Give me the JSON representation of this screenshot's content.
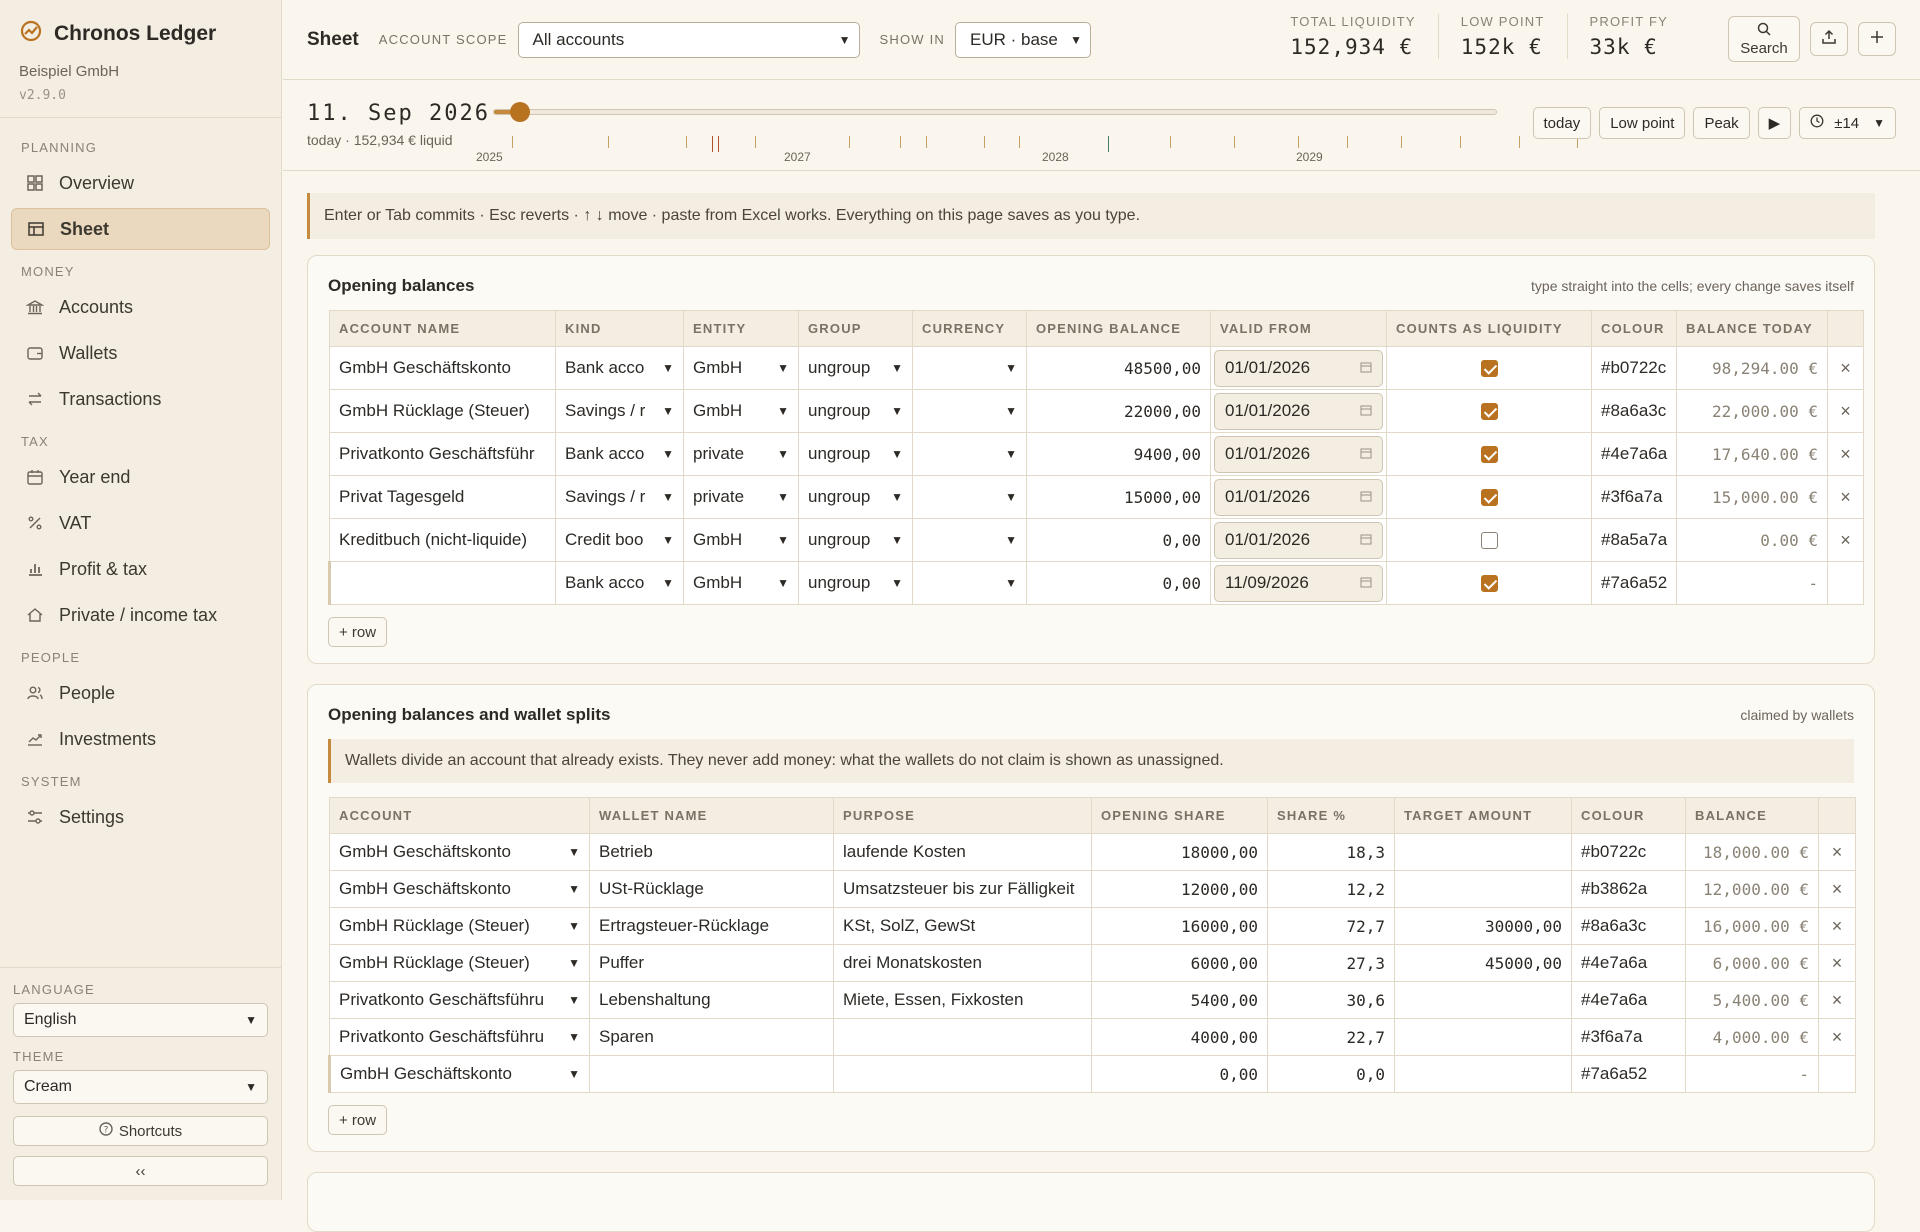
{
  "app": {
    "title": "Chronos Ledger",
    "company": "Beispiel GmbH",
    "version": "v2.9.0"
  },
  "sidebar": {
    "sections": [
      {
        "label": "PLANNING",
        "items": [
          {
            "label": "Overview",
            "icon": "grid-icon"
          },
          {
            "label": "Sheet",
            "icon": "table-icon",
            "active": true
          }
        ]
      },
      {
        "label": "MONEY",
        "items": [
          {
            "label": "Accounts",
            "icon": "bank-icon"
          },
          {
            "label": "Wallets",
            "icon": "wallet-icon"
          },
          {
            "label": "Transactions",
            "icon": "transfer-icon"
          }
        ]
      },
      {
        "label": "TAX",
        "items": [
          {
            "label": "Year end",
            "icon": "calendar-icon"
          },
          {
            "label": "VAT",
            "icon": "percent-icon"
          },
          {
            "label": "Profit & tax",
            "icon": "bar-chart-icon"
          },
          {
            "label": "Private / income tax",
            "icon": "home-icon"
          }
        ]
      },
      {
        "label": "PEOPLE",
        "items": [
          {
            "label": "People",
            "icon": "people-icon"
          },
          {
            "label": "Investments",
            "icon": "trend-icon"
          }
        ]
      },
      {
        "label": "SYSTEM",
        "items": [
          {
            "label": "Settings",
            "icon": "sliders-icon"
          }
        ]
      }
    ],
    "language_label": "LANGUAGE",
    "language_value": "English",
    "theme_label": "THEME",
    "theme_value": "Cream",
    "shortcuts_label": "Shortcuts",
    "collapse_label": "‹‹"
  },
  "topbar": {
    "title": "Sheet",
    "scope_label": "ACCOUNT SCOPE",
    "scope_value": "All accounts",
    "show_label": "SHOW IN",
    "show_value": "EUR · base",
    "kpis": [
      {
        "label": "TOTAL LIQUIDITY",
        "value": "152,934 €"
      },
      {
        "label": "LOW POINT",
        "value": "152k €"
      },
      {
        "label": "PROFIT FY",
        "value": "33k €"
      }
    ],
    "search_label": "Search"
  },
  "timeline": {
    "date": "11. Sep 2026",
    "sub": "today · 152,934 € liquid",
    "years": [
      "2025",
      "2027",
      "2028",
      "2029"
    ],
    "progress": 0.02,
    "buttons": {
      "today": "today",
      "low": "Low point",
      "peak": "Peak",
      "window": "±14"
    }
  },
  "hint": "Enter or Tab commits · Esc reverts · ↑ ↓ move · paste from Excel works. Everything on this page saves as you type.",
  "opening": {
    "title": "Opening balances",
    "note": "type straight into the cells; every change saves itself",
    "columns": [
      "ACCOUNT NAME",
      "KIND",
      "ENTITY",
      "GROUP",
      "CURRENCY",
      "OPENING BALANCE",
      "VALID FROM",
      "COUNTS AS LIQUIDITY",
      "COLOUR",
      "BALANCE TODAY"
    ],
    "rows": [
      {
        "name": "GmbH Geschäftskonto",
        "kind": "Bank acco",
        "entity": "GmbH",
        "group": "ungroup",
        "currency": "",
        "opening": "48500,00",
        "valid": "01/01/2026",
        "liquid": true,
        "colour": "#b0722c",
        "balance": "98,294.00 €",
        "del": "×"
      },
      {
        "name": "GmbH Rücklage (Steuer)",
        "kind": "Savings / r",
        "entity": "GmbH",
        "group": "ungroup",
        "currency": "",
        "opening": "22000,00",
        "valid": "01/01/2026",
        "liquid": true,
        "colour": "#8a6a3c",
        "balance": "22,000.00 €",
        "del": "×"
      },
      {
        "name": "Privatkonto Geschäftsführ",
        "kind": "Bank acco",
        "entity": "private",
        "group": "ungroup",
        "currency": "",
        "opening": "9400,00",
        "valid": "01/01/2026",
        "liquid": true,
        "colour": "#4e7a6a",
        "balance": "17,640.00 €",
        "del": "×"
      },
      {
        "name": "Privat Tagesgeld",
        "kind": "Savings / r",
        "entity": "private",
        "group": "ungroup",
        "currency": "",
        "opening": "15000,00",
        "valid": "01/01/2026",
        "liquid": true,
        "colour": "#3f6a7a",
        "balance": "15,000.00 €",
        "del": "×"
      },
      {
        "name": "Kreditbuch (nicht-liquide)",
        "kind": "Credit boo",
        "entity": "GmbH",
        "group": "ungroup",
        "currency": "",
        "opening": "0,00",
        "valid": "01/01/2026",
        "liquid": false,
        "colour": "#8a5a7a",
        "balance": "0.00 €",
        "del": "×"
      },
      {
        "name": "",
        "kind": "Bank acco",
        "entity": "GmbH",
        "group": "ungroup",
        "currency": "",
        "opening": "0,00",
        "valid": "11/09/2026",
        "liquid": true,
        "colour": "#7a6a52",
        "balance": "-",
        "del": ""
      }
    ],
    "add_row": "+ row"
  },
  "wallets": {
    "title": "Opening balances and wallet splits",
    "note": "claimed by wallets",
    "hint": "Wallets divide an account that already exists. They never add money: what the wallets do not claim is shown as unassigned.",
    "columns": [
      "ACCOUNT",
      "WALLET NAME",
      "PURPOSE",
      "OPENING SHARE",
      "SHARE %",
      "TARGET AMOUNT",
      "COLOUR",
      "BALANCE"
    ],
    "rows": [
      {
        "account": "GmbH Geschäftskonto",
        "wallet": "Betrieb",
        "purpose": "laufende Kosten",
        "share": "18000,00",
        "pct": "18,3",
        "target": "",
        "colour": "#b0722c",
        "balance": "18,000.00 €",
        "del": "×"
      },
      {
        "account": "GmbH Geschäftskonto",
        "wallet": "USt-Rücklage",
        "purpose": "Umsatzsteuer bis zur Fälligkeit",
        "share": "12000,00",
        "pct": "12,2",
        "target": "",
        "colour": "#b3862a",
        "balance": "12,000.00 €",
        "del": "×"
      },
      {
        "account": "GmbH Rücklage (Steuer)",
        "wallet": "Ertragsteuer-Rücklage",
        "purpose": "KSt, SolZ, GewSt",
        "share": "16000,00",
        "pct": "72,7",
        "target": "30000,00",
        "colour": "#8a6a3c",
        "balance": "16,000.00 €",
        "del": "×"
      },
      {
        "account": "GmbH Rücklage (Steuer)",
        "wallet": "Puffer",
        "purpose": "drei Monatskosten",
        "share": "6000,00",
        "pct": "27,3",
        "target": "45000,00",
        "colour": "#4e7a6a",
        "balance": "6,000.00 €",
        "del": "×"
      },
      {
        "account": "Privatkonto Geschäftsführu",
        "wallet": "Lebenshaltung",
        "purpose": "Miete, Essen, Fixkosten",
        "share": "5400,00",
        "pct": "30,6",
        "target": "",
        "colour": "#4e7a6a",
        "balance": "5,400.00 €",
        "del": "×"
      },
      {
        "account": "Privatkonto Geschäftsführu",
        "wallet": "Sparen",
        "purpose": "",
        "share": "4000,00",
        "pct": "22,7",
        "target": "",
        "colour": "#3f6a7a",
        "balance": "4,000.00 €",
        "del": "×"
      },
      {
        "account": "GmbH Geschäftskonto",
        "wallet": "",
        "purpose": "",
        "share": "0,00",
        "pct": "0,0",
        "target": "",
        "colour": "#7a6a52",
        "balance": "-",
        "del": ""
      }
    ],
    "add_row": "+ row"
  },
  "colors": {
    "accent": "#b97320",
    "background": "#faf6ee",
    "sidebar": "#f3ede2"
  }
}
